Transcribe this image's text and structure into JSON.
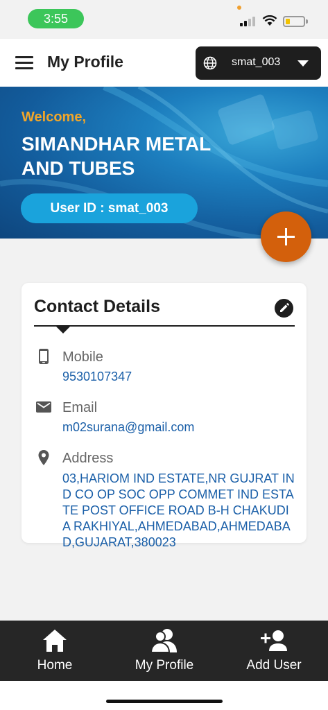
{
  "status_bar": {
    "time": "3:55"
  },
  "app_bar": {
    "title": "My Profile",
    "user_selector": {
      "value": "smat_003",
      "icon": "globe-icon"
    }
  },
  "banner": {
    "welcome": "Welcome,",
    "company_name": "SIMANDHAR METAL AND TUBES",
    "user_id_label": "User ID : smat_003"
  },
  "fab": {
    "icon": "plus-icon"
  },
  "contact_card": {
    "title": "Contact Details",
    "edit_icon": "pencil-icon",
    "mobile": {
      "label": "Mobile",
      "value": "9530107347",
      "icon": "phone-icon"
    },
    "email": {
      "label": "Email",
      "value": "m02surana@gmail.com",
      "icon": "mail-icon"
    },
    "address": {
      "label": "Address",
      "value": "03,HARIOM IND ESTATE,NR GUJRAT IND CO OP SOC OPP COMMET IND ESTATE POST OFFICE ROAD B-H CHAKUDIA RAKHIYAL,AHMEDABAD,AHMEDABAD,GUJARAT,380023",
      "icon": "location-pin-icon"
    }
  },
  "bottom_nav": {
    "items": [
      {
        "label": "Home",
        "icon": "home-icon"
      },
      {
        "label": "My Profile",
        "icon": "users-icon"
      },
      {
        "label": "Add User",
        "icon": "add-user-icon"
      }
    ]
  },
  "colors": {
    "accent_orange": "#d3600c",
    "welcome_orange": "#f0a62a",
    "pill_blue": "#1aa3dc",
    "link_blue": "#1a5fa8",
    "nav_bg": "#262626"
  }
}
